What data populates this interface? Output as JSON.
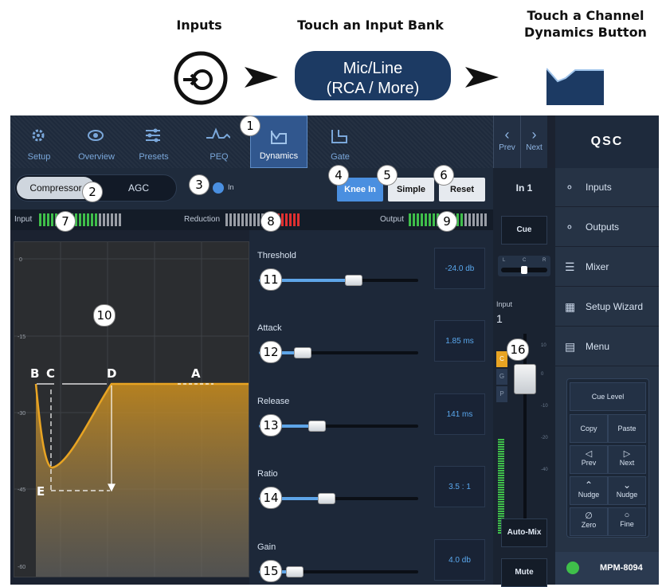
{
  "instructions": {
    "step1_title": "Inputs",
    "step2_title": "Touch an Input Bank",
    "step2_button": [
      "Mic/Line",
      "(RCA / More)"
    ],
    "step3_title": [
      "Touch a Channel",
      "Dynamics Button"
    ]
  },
  "tabs": [
    {
      "label": "Setup",
      "icon": "gear-icon"
    },
    {
      "label": "Overview",
      "icon": "eye-icon"
    },
    {
      "label": "Presets",
      "icon": "sliders-icon"
    },
    {
      "label": "PEQ",
      "icon": "eq-curve-icon"
    },
    {
      "label": "Dynamics",
      "icon": "dynamics-icon",
      "active": true
    },
    {
      "label": "Gate",
      "icon": "gate-icon"
    }
  ],
  "nav": {
    "prev": "Prev",
    "next": "Next"
  },
  "brand": "QSC",
  "controls": {
    "compressor": "Compressor",
    "agc": "AGC",
    "in_label": "In",
    "knee_in": "Knee In",
    "simple": "Simple",
    "reset": "Reset"
  },
  "meters": {
    "input": "Input",
    "reduction": "Reduction",
    "output": "Output"
  },
  "graph": {
    "y_ticks": [
      "0",
      "-15",
      "-30",
      "-45",
      "-60"
    ],
    "letters": [
      "B",
      "C",
      "D",
      "A",
      "E"
    ]
  },
  "params": [
    {
      "label": "Threshold",
      "value": "-24.0 db",
      "level": 0.62
    },
    {
      "label": "Attack",
      "value": "1.85 ms",
      "level": 0.25
    },
    {
      "label": "Release",
      "value": "141 ms",
      "level": 0.35
    },
    {
      "label": "Ratio",
      "value": "3.5 : 1",
      "level": 0.42
    },
    {
      "label": "Gain",
      "value": "4.0 db",
      "level": 0.18
    }
  ],
  "channel": {
    "name": "In 1",
    "cue": "Cue",
    "pan_labels": [
      "L",
      "C",
      "R"
    ],
    "input_label": "Input",
    "input_num": "1",
    "cgp": [
      "C",
      "G",
      "P"
    ],
    "fader_scale": [
      "10",
      "0",
      "-10",
      "-20",
      "-40"
    ],
    "automix": "Auto-Mix",
    "mute": "Mute"
  },
  "sidebar": {
    "items": [
      {
        "label": "Inputs",
        "icon": "inputs-icon"
      },
      {
        "label": "Outputs",
        "icon": "outputs-icon"
      },
      {
        "label": "Mixer",
        "icon": "mixer-icon"
      },
      {
        "label": "Setup Wizard",
        "icon": "wizard-icon"
      },
      {
        "label": "Menu",
        "icon": "menu-icon"
      }
    ],
    "cue_level": "Cue Level",
    "copy": "Copy",
    "paste": "Paste",
    "prev": "Prev",
    "next": "Next",
    "nudge_up": "Nudge",
    "nudge_down": "Nudge",
    "zero": "Zero",
    "fine": "Fine",
    "device": "MPM-8094"
  },
  "callouts": [
    "1",
    "2",
    "3",
    "4",
    "5",
    "6",
    "7",
    "8",
    "9",
    "10",
    "11",
    "12",
    "13",
    "14",
    "15",
    "16"
  ],
  "colors": {
    "accent": "#4a8fe0",
    "active_tab": "#31578e",
    "curve": "#e8a423",
    "meter_green": "#3fbf4a",
    "meter_red": "#e03030"
  }
}
